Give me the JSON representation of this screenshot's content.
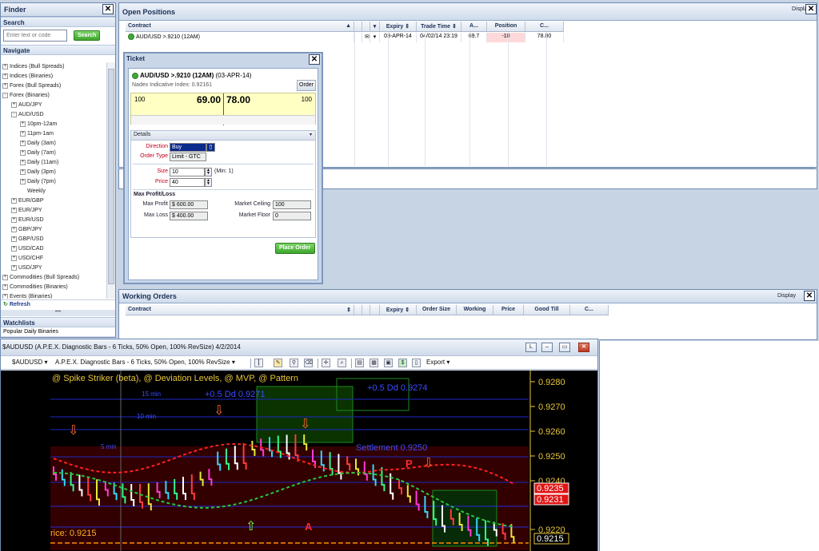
{
  "finder": {
    "title": "Finder",
    "search_header": "Search",
    "search_placeholder": "Enter text or code",
    "search_button": "Search",
    "navigate_header": "Navigate",
    "tree": [
      {
        "label": "Indices (Bull Spreads)",
        "level": 0,
        "toggle": "+"
      },
      {
        "label": "Indices (Binaries)",
        "level": 0,
        "toggle": "+"
      },
      {
        "label": "Forex (Bull Spreads)",
        "level": 0,
        "toggle": "+"
      },
      {
        "label": "Forex (Binaries)",
        "level": 0,
        "toggle": "-"
      },
      {
        "label": "AUD/JPY",
        "level": 1,
        "toggle": "+"
      },
      {
        "label": "AUD/USD",
        "level": 1,
        "toggle": "-"
      },
      {
        "label": "10pm-12am",
        "level": 2,
        "toggle": "+"
      },
      {
        "label": "11pm-1am",
        "level": 2,
        "toggle": "+"
      },
      {
        "label": "Daily (3am)",
        "level": 2,
        "toggle": "+"
      },
      {
        "label": "Daily (7am)",
        "level": 2,
        "toggle": "+"
      },
      {
        "label": "Daily (11am)",
        "level": 2,
        "toggle": "+"
      },
      {
        "label": "Daily (3pm)",
        "level": 2,
        "toggle": "+"
      },
      {
        "label": "Daily (7pm)",
        "level": 2,
        "toggle": "+"
      },
      {
        "label": "Weekly",
        "level": 2,
        "toggle": ""
      },
      {
        "label": "EUR/GBP",
        "level": 1,
        "toggle": "+"
      },
      {
        "label": "EUR/JPY",
        "level": 1,
        "toggle": "+"
      },
      {
        "label": "EUR/USD",
        "level": 1,
        "toggle": "+"
      },
      {
        "label": "GBP/JPY",
        "level": 1,
        "toggle": "+"
      },
      {
        "label": "GBP/USD",
        "level": 1,
        "toggle": "+"
      },
      {
        "label": "USD/CAD",
        "level": 1,
        "toggle": "+"
      },
      {
        "label": "USD/CHF",
        "level": 1,
        "toggle": "+"
      },
      {
        "label": "USD/JPY",
        "level": 1,
        "toggle": "+"
      },
      {
        "label": "Commodities (Bull Spreads)",
        "level": 0,
        "toggle": "+"
      },
      {
        "label": "Commodities (Binaries)",
        "level": 0,
        "toggle": "+"
      },
      {
        "label": "Events (Binaries)",
        "level": 0,
        "toggle": "+"
      }
    ],
    "refresh_label": "Refresh",
    "watchlists_header": "Watchlists",
    "watchlist_item": "Popular Daily Binaries"
  },
  "open_positions": {
    "title": "Open Positions",
    "display_label": "Display",
    "columns": [
      "Contract",
      "",
      "",
      "",
      "Expiry",
      "Trade Time",
      "A...",
      "Position",
      "C..."
    ],
    "row": {
      "contract": "AUD/USD >.9210 (12AM)",
      "expiry": "03-APR-14",
      "trade_time": "04/02/14 23:19",
      "a": "69.7",
      "position": "-10",
      "c": "78.00"
    }
  },
  "ticket": {
    "title": "Ticket",
    "contract": "AUD/USD >.9210 (12AM)",
    "expiry": "(03-APR-14)",
    "index_label": "Nadex Indicative Index: 0.92161",
    "order_tab": "Order",
    "bid_size": "100",
    "bid": "69.00",
    "offer": "78.00",
    "offer_size": "100",
    "details_label": "Details",
    "direction_label": "Direction",
    "direction_value": "Buy",
    "order_type_label": "Order Type",
    "order_type_value": "Limit - GTC",
    "size_label": "Size",
    "size_value": "10",
    "size_min": "(Min: 1)",
    "price_label": "Price",
    "price_value": "40",
    "maxpl_header": "Max Profit/Loss",
    "max_profit_label": "Max Profit",
    "max_profit_value": "$ 600.00",
    "max_loss_label": "Max Loss",
    "max_loss_value": "$ 400.00",
    "market_ceiling_label": "Market Ceiling",
    "market_ceiling_value": "100",
    "market_floor_label": "Market Floor",
    "market_floor_value": "0",
    "place_order": "Place Order"
  },
  "working_orders": {
    "title": "Working Orders",
    "display_label": "Display",
    "columns": [
      "Contract",
      "",
      "",
      "",
      "Expiry",
      "Order Size",
      "Working",
      "Price",
      "Good Till",
      "C..."
    ]
  },
  "chart_window": {
    "title": "$AUDUSD (A.P.E.X. Diagnostic Bars - 6 Ticks, 50% Open, 100% RevSize)  4/2/2014",
    "btn_l": "L",
    "symbol": "$AUDUSD",
    "bar_type": "A.P.E.X. Diagnostic Bars - 6 Ticks, 50% Open, 100% RevSize",
    "export": "Export",
    "studies_label": "@ Spike Striker (beta), @ Deviation Levels, @ MVP, @ Pattern",
    "price_ticks": [
      "0.9280",
      "0.9270",
      "0.9260",
      "0.9250",
      "0.9240",
      "0.9220"
    ],
    "price_tags": [
      {
        "text": "0.9235",
        "color": "#e01414"
      },
      {
        "text": "0.9231",
        "color": "#e01414"
      },
      {
        "text": "0.9215",
        "color": "#000000"
      }
    ],
    "annotations": [
      "+0.5 Dd 0.9271",
      "+0.5 Dd 0.9274",
      "Settlement 0.9250",
      "rice: 0.9215",
      "15 min",
      "10 min",
      "5 min"
    ]
  }
}
